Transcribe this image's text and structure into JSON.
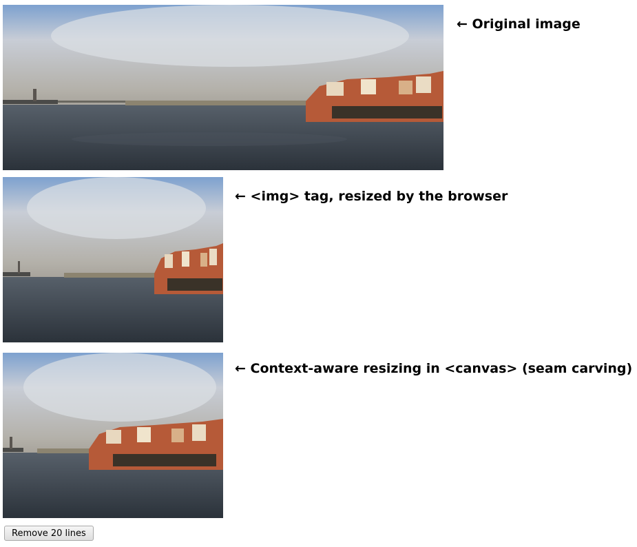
{
  "rows": [
    {
      "caption": "← Original image",
      "image_name": "harbour-photo-original"
    },
    {
      "caption": "← <img> tag, resized by the browser",
      "image_name": "harbour-photo-browser-resized"
    },
    {
      "caption": "← Context-aware resizing in <canvas> (seam carving)",
      "image_name": "harbour-photo-seam-carved"
    }
  ],
  "button": {
    "label": "Remove 20 lines"
  },
  "colors": {
    "sky_top": "#6d93c4",
    "cloud": "#cfd3db",
    "horizon": "#a9a59c",
    "water": "#3e4650",
    "water_dark": "#2a3038",
    "houses": "#c7673f",
    "houses_light": "#e6c9a0",
    "pier": "#3a3228"
  }
}
